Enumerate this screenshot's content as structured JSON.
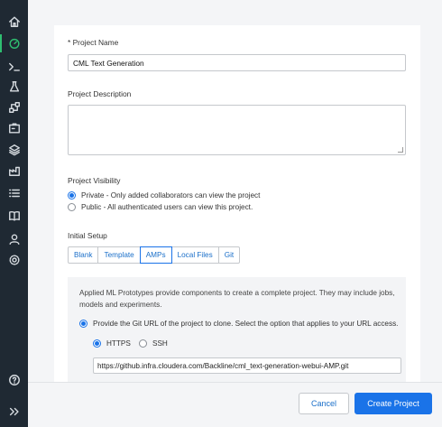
{
  "sidebar": {
    "items": [
      {
        "icon": "home-icon"
      },
      {
        "icon": "speedometer-icon"
      },
      {
        "icon": "terminal-icon"
      },
      {
        "icon": "flask-icon"
      },
      {
        "icon": "workflow-icon"
      },
      {
        "icon": "jobs-icon"
      },
      {
        "icon": "layers-icon"
      },
      {
        "icon": "factory-icon"
      },
      {
        "icon": "list-icon"
      },
      {
        "icon": "book-icon"
      },
      {
        "icon": "user-icon"
      },
      {
        "icon": "settings-icon"
      },
      {
        "icon": "help-icon"
      },
      {
        "icon": "expand-icon"
      }
    ],
    "accent_color": "#2fbf71"
  },
  "form": {
    "project_name_label": "* Project Name",
    "project_name_value": "CML Text Generation",
    "project_description_label": "Project Description",
    "project_description_value": "",
    "visibility_label": "Project Visibility",
    "visibility_options": [
      {
        "label": "Private - Only added collaborators can view the project",
        "selected": true
      },
      {
        "label": "Public - All authenticated users can view this project.",
        "selected": false
      }
    ],
    "initial_setup_label": "Initial Setup",
    "setup_tabs": [
      {
        "label": "Blank",
        "active": false
      },
      {
        "label": "Template",
        "active": false
      },
      {
        "label": "AMPs",
        "active": true
      },
      {
        "label": "Local Files",
        "active": false
      },
      {
        "label": "Git",
        "active": false
      }
    ],
    "amp_description": "Applied ML Prototypes provide components to create a complete project. They may include jobs, models and experiments.",
    "git_url_option": "Provide the Git URL of the project to clone. Select the option that applies to your URL access.",
    "protocol_options": [
      {
        "label": "HTTPS",
        "selected": true
      },
      {
        "label": "SSH",
        "selected": false
      }
    ],
    "git_url_value": "https://github.infra.cloudera.com/Backline/cml_text-generation-webui-AMP.git"
  },
  "footer": {
    "cancel_label": "Cancel",
    "create_label": "Create Project"
  },
  "colors": {
    "primary": "#1a73e8",
    "sidebar_bg": "#1f2933"
  }
}
